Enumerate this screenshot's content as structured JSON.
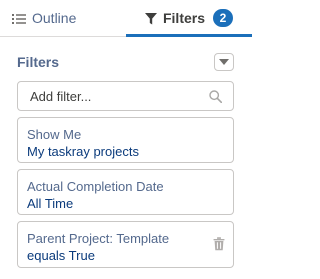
{
  "tabs": {
    "outline": {
      "label": "Outline",
      "icon": "list-icon"
    },
    "filters": {
      "label": "Filters",
      "icon": "funnel-icon",
      "badge": "2",
      "active": true
    }
  },
  "colors": {
    "accent": "#1b6fba",
    "label": "#54698d",
    "value": "#0b3b7c",
    "border": "#c9c7c5"
  },
  "filters_section": {
    "title": "Filters",
    "menu_icon": "chevron-down-icon"
  },
  "search": {
    "placeholder": "Add filter...",
    "value": "",
    "icon": "search-icon"
  },
  "filters": [
    {
      "label": "Show Me",
      "value": "My taskray projects"
    },
    {
      "label": "Actual Completion Date",
      "value": "All Time"
    },
    {
      "label": "Parent Project: Template",
      "value": "equals True",
      "removable": true,
      "remove_icon": "trash-icon"
    }
  ]
}
